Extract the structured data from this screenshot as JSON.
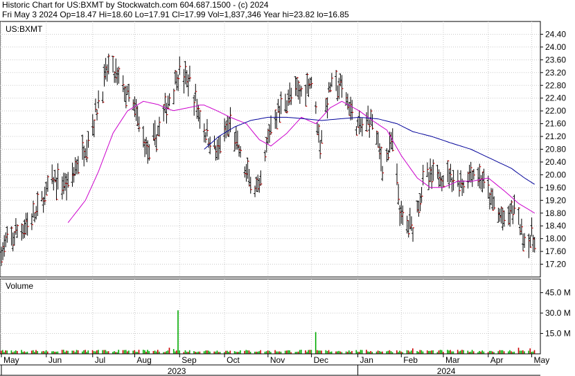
{
  "header": {
    "line1": "Historic Chart for US:BXMT by Stockwatch.com 604.687.1500 - (c) 2024",
    "line2": "Fri May  3 2024  Op=18.47  Hi=18.60  Lo=17.91  Cl=17.99  Vol=1,837,346  Year hi=23.82  lo=16.85"
  },
  "chart_data": [
    {
      "type": "ohlc",
      "title": "US:BXMT",
      "ylim": [
        16.8,
        24.8
      ],
      "y_ticks": [
        "17.20",
        "17.60",
        "18.00",
        "18.40",
        "18.80",
        "19.20",
        "19.60",
        "20.00",
        "20.40",
        "20.80",
        "21.20",
        "21.60",
        "22.00",
        "22.40",
        "22.80",
        "23.20",
        "23.60",
        "24.00",
        "24.40"
      ],
      "grid": true,
      "colors": {
        "bar": "#000000",
        "close_tick": "#cc0000",
        "ma_short": "#cc00cc",
        "ma_long": "#000099"
      },
      "price_anchors": [
        [
          "2023-05-01",
          17.6
        ],
        [
          "2023-05-12",
          18.2
        ],
        [
          "2023-05-24",
          18.7
        ],
        [
          "2023-06-05",
          19.8
        ],
        [
          "2023-06-16",
          19.7
        ],
        [
          "2023-06-28",
          20.9
        ],
        [
          "2023-07-05",
          21.9
        ],
        [
          "2023-07-14",
          23.4
        ],
        [
          "2023-07-21",
          23.0
        ],
        [
          "2023-08-01",
          22.0
        ],
        [
          "2023-08-11",
          20.6
        ],
        [
          "2023-08-22",
          22.0
        ],
        [
          "2023-08-31",
          23.2
        ],
        [
          "2023-09-08",
          22.9
        ],
        [
          "2023-09-18",
          21.4
        ],
        [
          "2023-09-27",
          20.7
        ],
        [
          "2023-10-06",
          21.6
        ],
        [
          "2023-10-17",
          20.0
        ],
        [
          "2023-10-26",
          19.4
        ],
        [
          "2023-11-03",
          21.6
        ],
        [
          "2023-11-14",
          22.4
        ],
        [
          "2023-11-24",
          22.6
        ],
        [
          "2023-12-01",
          23.0
        ],
        [
          "2023-12-07",
          21.0
        ],
        [
          "2023-12-14",
          22.8
        ],
        [
          "2023-12-22",
          22.7
        ],
        [
          "2024-01-03",
          21.4
        ],
        [
          "2024-01-12",
          21.8
        ],
        [
          "2024-01-19",
          20.3
        ],
        [
          "2024-01-26",
          21.0
        ],
        [
          "2024-02-01",
          18.6
        ],
        [
          "2024-02-09",
          18.4
        ],
        [
          "2024-02-16",
          19.8
        ],
        [
          "2024-02-27",
          20.0
        ],
        [
          "2024-03-06",
          20.0
        ],
        [
          "2024-03-14",
          19.7
        ],
        [
          "2024-03-21",
          20.1
        ],
        [
          "2024-03-28",
          19.8
        ],
        [
          "2024-04-05",
          19.0
        ],
        [
          "2024-04-12",
          18.5
        ],
        [
          "2024-04-19",
          19.0
        ],
        [
          "2024-04-26",
          18.0
        ],
        [
          "2024-05-03",
          17.99
        ]
      ],
      "ma_short_anchors": [
        [
          "2023-06-16",
          18.5
        ],
        [
          "2023-06-28",
          19.2
        ],
        [
          "2023-07-07",
          20.1
        ],
        [
          "2023-07-17",
          21.3
        ],
        [
          "2023-07-27",
          22.0
        ],
        [
          "2023-08-07",
          22.3
        ],
        [
          "2023-08-17",
          22.2
        ],
        [
          "2023-08-27",
          22.0
        ],
        [
          "2023-09-07",
          22.1
        ],
        [
          "2023-09-17",
          22.2
        ],
        [
          "2023-09-27",
          22.0
        ],
        [
          "2023-10-06",
          21.8
        ],
        [
          "2023-10-17",
          21.6
        ],
        [
          "2023-10-26",
          21.1
        ],
        [
          "2023-11-03",
          20.9
        ],
        [
          "2023-11-14",
          21.3
        ],
        [
          "2023-11-24",
          21.8
        ],
        [
          "2023-12-04",
          21.6
        ],
        [
          "2023-12-14",
          22.1
        ],
        [
          "2023-12-22",
          22.3
        ],
        [
          "2024-01-03",
          22.0
        ],
        [
          "2024-01-12",
          21.7
        ],
        [
          "2024-01-22",
          21.4
        ],
        [
          "2024-02-01",
          20.6
        ],
        [
          "2024-02-12",
          19.9
        ],
        [
          "2024-02-21",
          19.6
        ],
        [
          "2024-03-01",
          19.6
        ],
        [
          "2024-03-11",
          19.8
        ],
        [
          "2024-03-21",
          19.8
        ],
        [
          "2024-04-01",
          19.9
        ],
        [
          "2024-04-12",
          19.5
        ],
        [
          "2024-04-22",
          19.1
        ],
        [
          "2024-05-03",
          18.8
        ]
      ],
      "ma_long_anchors": [
        [
          "2023-09-18",
          20.8
        ],
        [
          "2023-09-28",
          21.2
        ],
        [
          "2023-10-09",
          21.5
        ],
        [
          "2023-10-20",
          21.7
        ],
        [
          "2023-11-01",
          21.8
        ],
        [
          "2023-11-14",
          21.8
        ],
        [
          "2023-11-27",
          21.75
        ],
        [
          "2023-12-08",
          21.7
        ],
        [
          "2023-12-20",
          21.75
        ],
        [
          "2024-01-03",
          21.8
        ],
        [
          "2024-01-16",
          21.75
        ],
        [
          "2024-01-29",
          21.6
        ],
        [
          "2024-02-09",
          21.35
        ],
        [
          "2024-02-22",
          21.2
        ],
        [
          "2024-03-06",
          21.0
        ],
        [
          "2024-03-20",
          20.8
        ],
        [
          "2024-04-03",
          20.5
        ],
        [
          "2024-04-17",
          20.2
        ],
        [
          "2024-04-26",
          19.9
        ],
        [
          "2024-05-03",
          19.7
        ]
      ]
    },
    {
      "type": "bar",
      "title": "Volume",
      "ylim": [
        0,
        55
      ],
      "y_ticks": [
        "15.0 M",
        "30.0 M",
        "45.0 M"
      ],
      "grid": true,
      "colors": {
        "bar_a": "#00aa00",
        "bar_b": "#cc0000"
      },
      "volume_spikes": [
        [
          "2023-08-31",
          32.0
        ],
        [
          "2023-12-04",
          16.0
        ],
        [
          "2023-08-25",
          4.5
        ],
        [
          "2023-08-28",
          3.5
        ],
        [
          "2023-11-24",
          3.0
        ],
        [
          "2024-02-09",
          4.0
        ],
        [
          "2024-04-22",
          4.5
        ],
        [
          "2024-04-30",
          4.0
        ]
      ],
      "baseline_volume_m": 2.0
    }
  ],
  "x_axis": {
    "months": [
      {
        "label": "May",
        "date": "2023-05-01"
      },
      {
        "label": "Jun",
        "date": "2023-06-01"
      },
      {
        "label": "Jul",
        "date": "2023-07-03"
      },
      {
        "label": "Aug",
        "date": "2023-08-01"
      },
      {
        "label": "Sep",
        "date": "2023-09-01"
      },
      {
        "label": "Oct",
        "date": "2023-10-02"
      },
      {
        "label": "Nov",
        "date": "2023-11-01"
      },
      {
        "label": "Dec",
        "date": "2023-12-01"
      },
      {
        "label": "Jan",
        "date": "2024-01-02"
      },
      {
        "label": "Feb",
        "date": "2024-02-01"
      },
      {
        "label": "Mar",
        "date": "2024-03-01"
      },
      {
        "label": "Apr",
        "date": "2024-04-01"
      },
      {
        "label": "May",
        "date": "2024-05-01"
      }
    ],
    "years": [
      {
        "label": "2023",
        "start": "2023-05-01",
        "end": "2023-12-29"
      },
      {
        "label": "2024",
        "start": "2024-01-02",
        "end": "2024-05-03"
      }
    ]
  }
}
